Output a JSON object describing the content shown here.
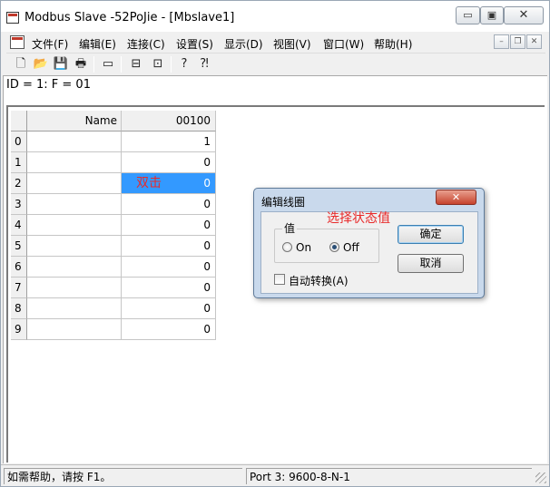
{
  "window": {
    "title": "Modbus Slave -52PoJie - [Mbslave1]",
    "min_glyph": "▭",
    "max_glyph": "▣",
    "close_glyph": "✕"
  },
  "menu": {
    "items": [
      "文件(F)",
      "编辑(E)",
      "连接(C)",
      "设置(S)",
      "显示(D)",
      "视图(V)",
      "窗口(W)",
      "帮助(H)"
    ],
    "mdi_min": "–",
    "mdi_restore": "❐",
    "mdi_close": "✕"
  },
  "toolbar": {
    "icons": [
      "new-icon",
      "open-icon",
      "save-icon",
      "print-icon",
      "window-icon",
      "connect-icon",
      "disconnect-icon",
      "help-icon",
      "context-help-icon"
    ],
    "glyphs": [
      "🗋",
      "📂",
      "💾",
      "🖶",
      "▭",
      "⊟",
      "⊡",
      "?",
      "⁈"
    ]
  },
  "main": {
    "info": "ID = 1: F = 01"
  },
  "grid": {
    "headers": {
      "name": "Name",
      "value": "00100"
    },
    "rows": [
      {
        "index": "0",
        "name": "",
        "value": "1"
      },
      {
        "index": "1",
        "name": "",
        "value": "0"
      },
      {
        "index": "2",
        "name": "",
        "value": "0"
      },
      {
        "index": "3",
        "name": "",
        "value": "0"
      },
      {
        "index": "4",
        "name": "",
        "value": "0"
      },
      {
        "index": "5",
        "name": "",
        "value": "0"
      },
      {
        "index": "6",
        "name": "",
        "value": "0"
      },
      {
        "index": "7",
        "name": "",
        "value": "0"
      },
      {
        "index": "8",
        "name": "",
        "value": "0"
      },
      {
        "index": "9",
        "name": "",
        "value": "0"
      }
    ],
    "annotation": "双击"
  },
  "dialog": {
    "title": "编辑线圈",
    "close_glyph": "✕",
    "group_label": "值",
    "radio_on": "On",
    "radio_off": "Off",
    "ok": "确定",
    "cancel": "取消",
    "auto_checkbox": "自动转换(A)",
    "annotation": "选择状态值"
  },
  "status": {
    "help": "如需帮助，请按 F1。",
    "port": "Port 3: 9600-8-N-1"
  },
  "colors": {
    "selection": "#3399ff",
    "annotation": "#e82a2a",
    "dialog_frame": "#c9d9ec"
  }
}
